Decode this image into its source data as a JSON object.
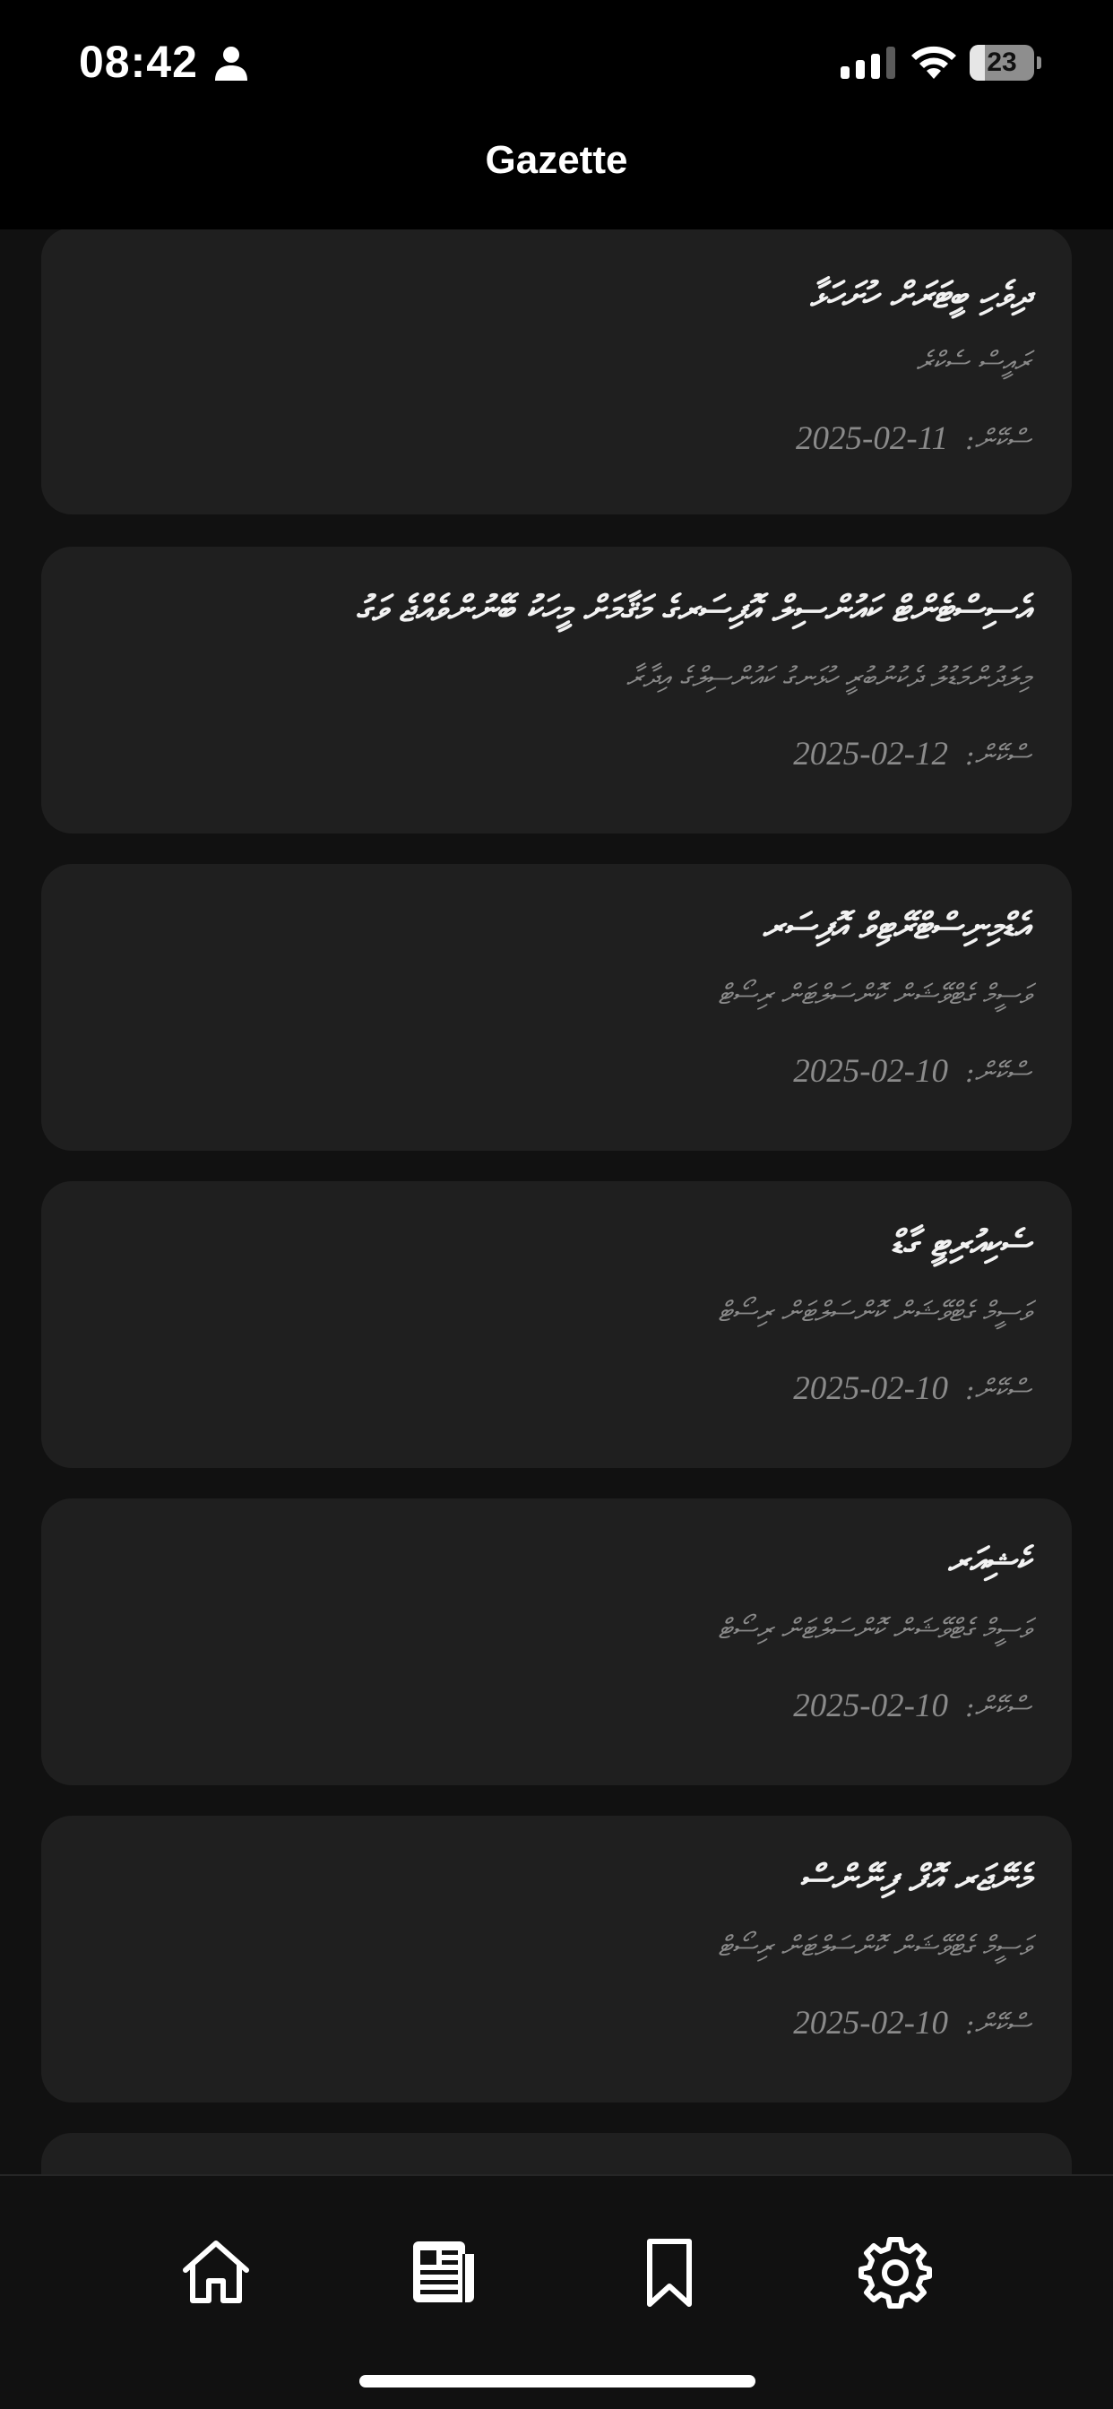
{
  "status_bar": {
    "time": "08:42",
    "battery_level": "23",
    "icons": [
      "person-icon",
      "cellular-signal-icon",
      "wifi-icon",
      "battery-icon"
    ]
  },
  "header": {
    "title": "Gazette"
  },
  "articles": [
    {
      "title": "ދިވެހި ބީޓަރަށް ހުށަހަޅާ",
      "subtitle": "ރައީސް ސެކްރެ",
      "date_label": "ސްކޭން:",
      "date": "2025-02-11"
    },
    {
      "title": "އެސިސްޓެންޓް ކައުންސިލް އޮފިސަރގެ މަޤާމަށް މީހަކު ބޭނުންވެއްޖެ ވަގު",
      "subtitle": "މިލަދުންމަޑުލު ދެކުނުބުރީ ހުޅަނގު ކައުންސިލްގެ އިދާރާ",
      "date_label": "ސްކޭން:",
      "date": "2025-02-12"
    },
    {
      "title": "އެޑްމިނިސްޓްރޭޓިވް އޮފިސަރ",
      "subtitle": "ވަސީމް ގެޓްވޭޝަން ކޮންސަލްޓަން ރިސޯޓް",
      "date_label": "ސްކޭން:",
      "date": "2025-02-10"
    },
    {
      "title": "ސެކިއުރިޓީ ގާޑް",
      "subtitle": "ވަސީމް ގެޓްވޭޝަން ކޮންސަލްޓަން ރިސޯޓް",
      "date_label": "ސްކޭން:",
      "date": "2025-02-10"
    },
    {
      "title": "ކެޝިއަރ",
      "subtitle": "ވަސީމް ގެޓްވޭޝަން ކޮންސަލްޓަން ރިސޯޓް",
      "date_label": "ސްކޭން:",
      "date": "2025-02-10"
    },
    {
      "title": "މެނޭޖަރ އޮފް ފިނޭންސް",
      "subtitle": "ވަސީމް ގެޓްވޭޝަން ކޮންސަލްޓަން ރިސޯޓް",
      "date_label": "ސްކޭން:",
      "date": "2025-02-10"
    }
  ],
  "tab_bar": {
    "tabs": [
      {
        "name": "home",
        "icon": "home-icon",
        "active": false
      },
      {
        "name": "gazette",
        "icon": "newspaper-icon",
        "active": true
      },
      {
        "name": "bookmarks",
        "icon": "bookmark-icon",
        "active": false
      },
      {
        "name": "settings",
        "icon": "gear-icon",
        "active": false
      }
    ]
  },
  "colors": {
    "background": "#111111",
    "bar_background": "#000000",
    "card_background": "#1f1f1f",
    "title_text": "#f2f2f2",
    "secondary_text": "#8a8a8a",
    "accent": "#ffffff"
  }
}
